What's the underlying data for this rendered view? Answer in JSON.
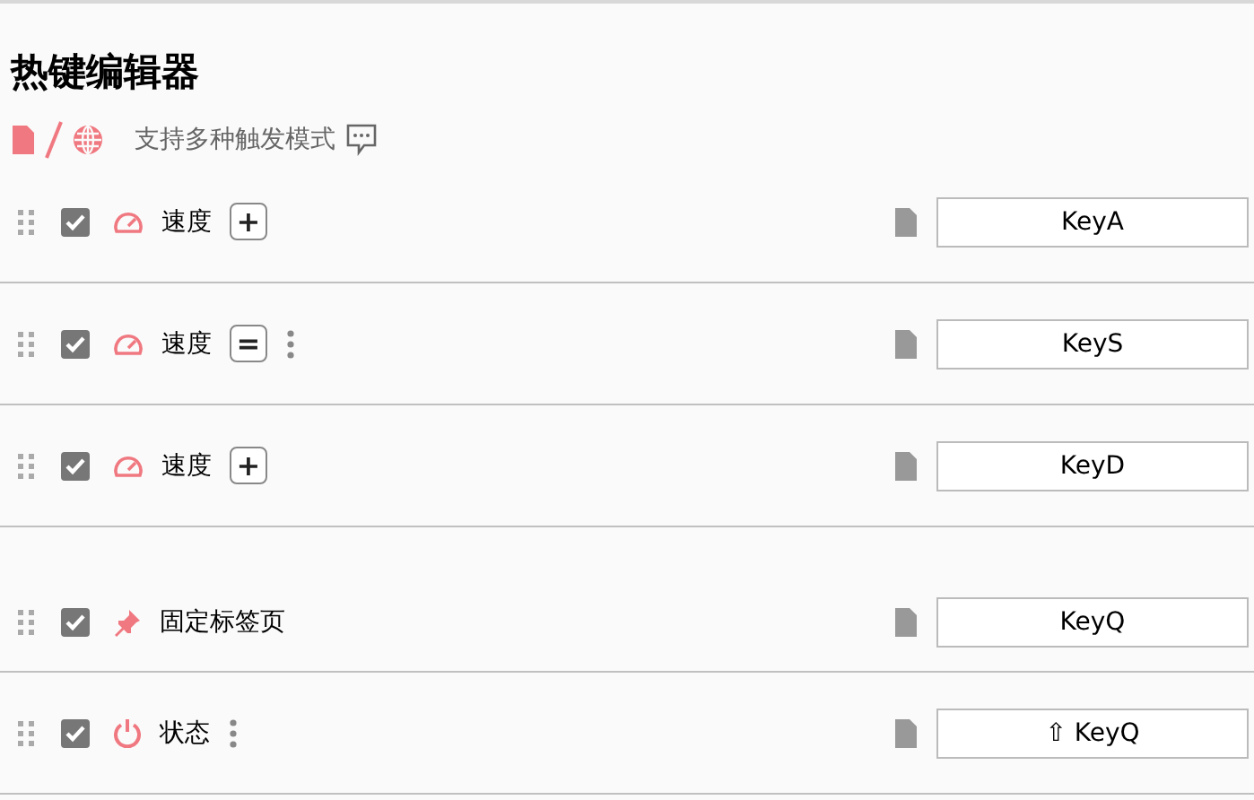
{
  "title": "热键编辑器",
  "subtitle": {
    "text": "支持多种触发模式"
  },
  "rows": [
    {
      "checked": true,
      "kind": "speed",
      "label": "速度",
      "op": "+",
      "menu": false,
      "key": "KeyA",
      "spaced": false
    },
    {
      "checked": true,
      "kind": "speed",
      "label": "速度",
      "op": "=",
      "menu": true,
      "key": "KeyS",
      "spaced": false
    },
    {
      "checked": true,
      "kind": "speed",
      "label": "速度",
      "op": "+",
      "menu": false,
      "key": "KeyD",
      "spaced": false
    },
    {
      "checked": true,
      "kind": "pin",
      "label": "固定标签页",
      "menu": false,
      "key": "KeyQ",
      "spaced": true
    },
    {
      "checked": true,
      "kind": "power",
      "label": "状态",
      "menu": true,
      "key": "⇧ KeyQ",
      "spaced": false
    }
  ]
}
